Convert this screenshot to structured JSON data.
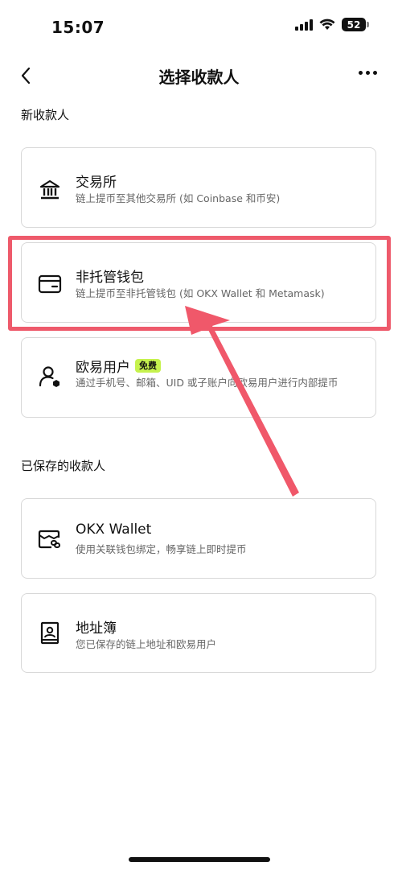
{
  "status_bar": {
    "time": "15:07",
    "battery": "52",
    "icons": [
      "signal-icon",
      "wifi-icon",
      "battery-icon"
    ]
  },
  "nav": {
    "back_icon": "chevron-left-icon",
    "title": "选择收款人",
    "more_icon": "more-icon"
  },
  "new_recipient": {
    "section_title": "新收款人",
    "items": [
      {
        "icon": "bank-icon",
        "title": "交易所",
        "desc": "链上提币至其他交易所 (如 Coinbase 和币安)"
      },
      {
        "icon": "wallet-icon",
        "title": "非托管钱包",
        "desc": "链上提币至非托管钱包 (如 OKX Wallet 和 Metamask)"
      },
      {
        "icon": "user-icon",
        "title": "欧易用户",
        "badge": "免费",
        "desc": "通过手机号、邮箱、UID 或子账户向欧易用户进行内部提币"
      }
    ]
  },
  "saved_recipient": {
    "section_title": "已保存的收款人",
    "items": [
      {
        "icon": "linked-wallet-icon",
        "title": "OKX Wallet",
        "desc": "使用关联钱包绑定，畅享链上即时提币"
      },
      {
        "icon": "address-book-icon",
        "title": "地址簿",
        "desc": "您已保存的链上地址和欧易用户"
      }
    ]
  },
  "annotation": {
    "highlight_color": "#ee5a6b"
  }
}
